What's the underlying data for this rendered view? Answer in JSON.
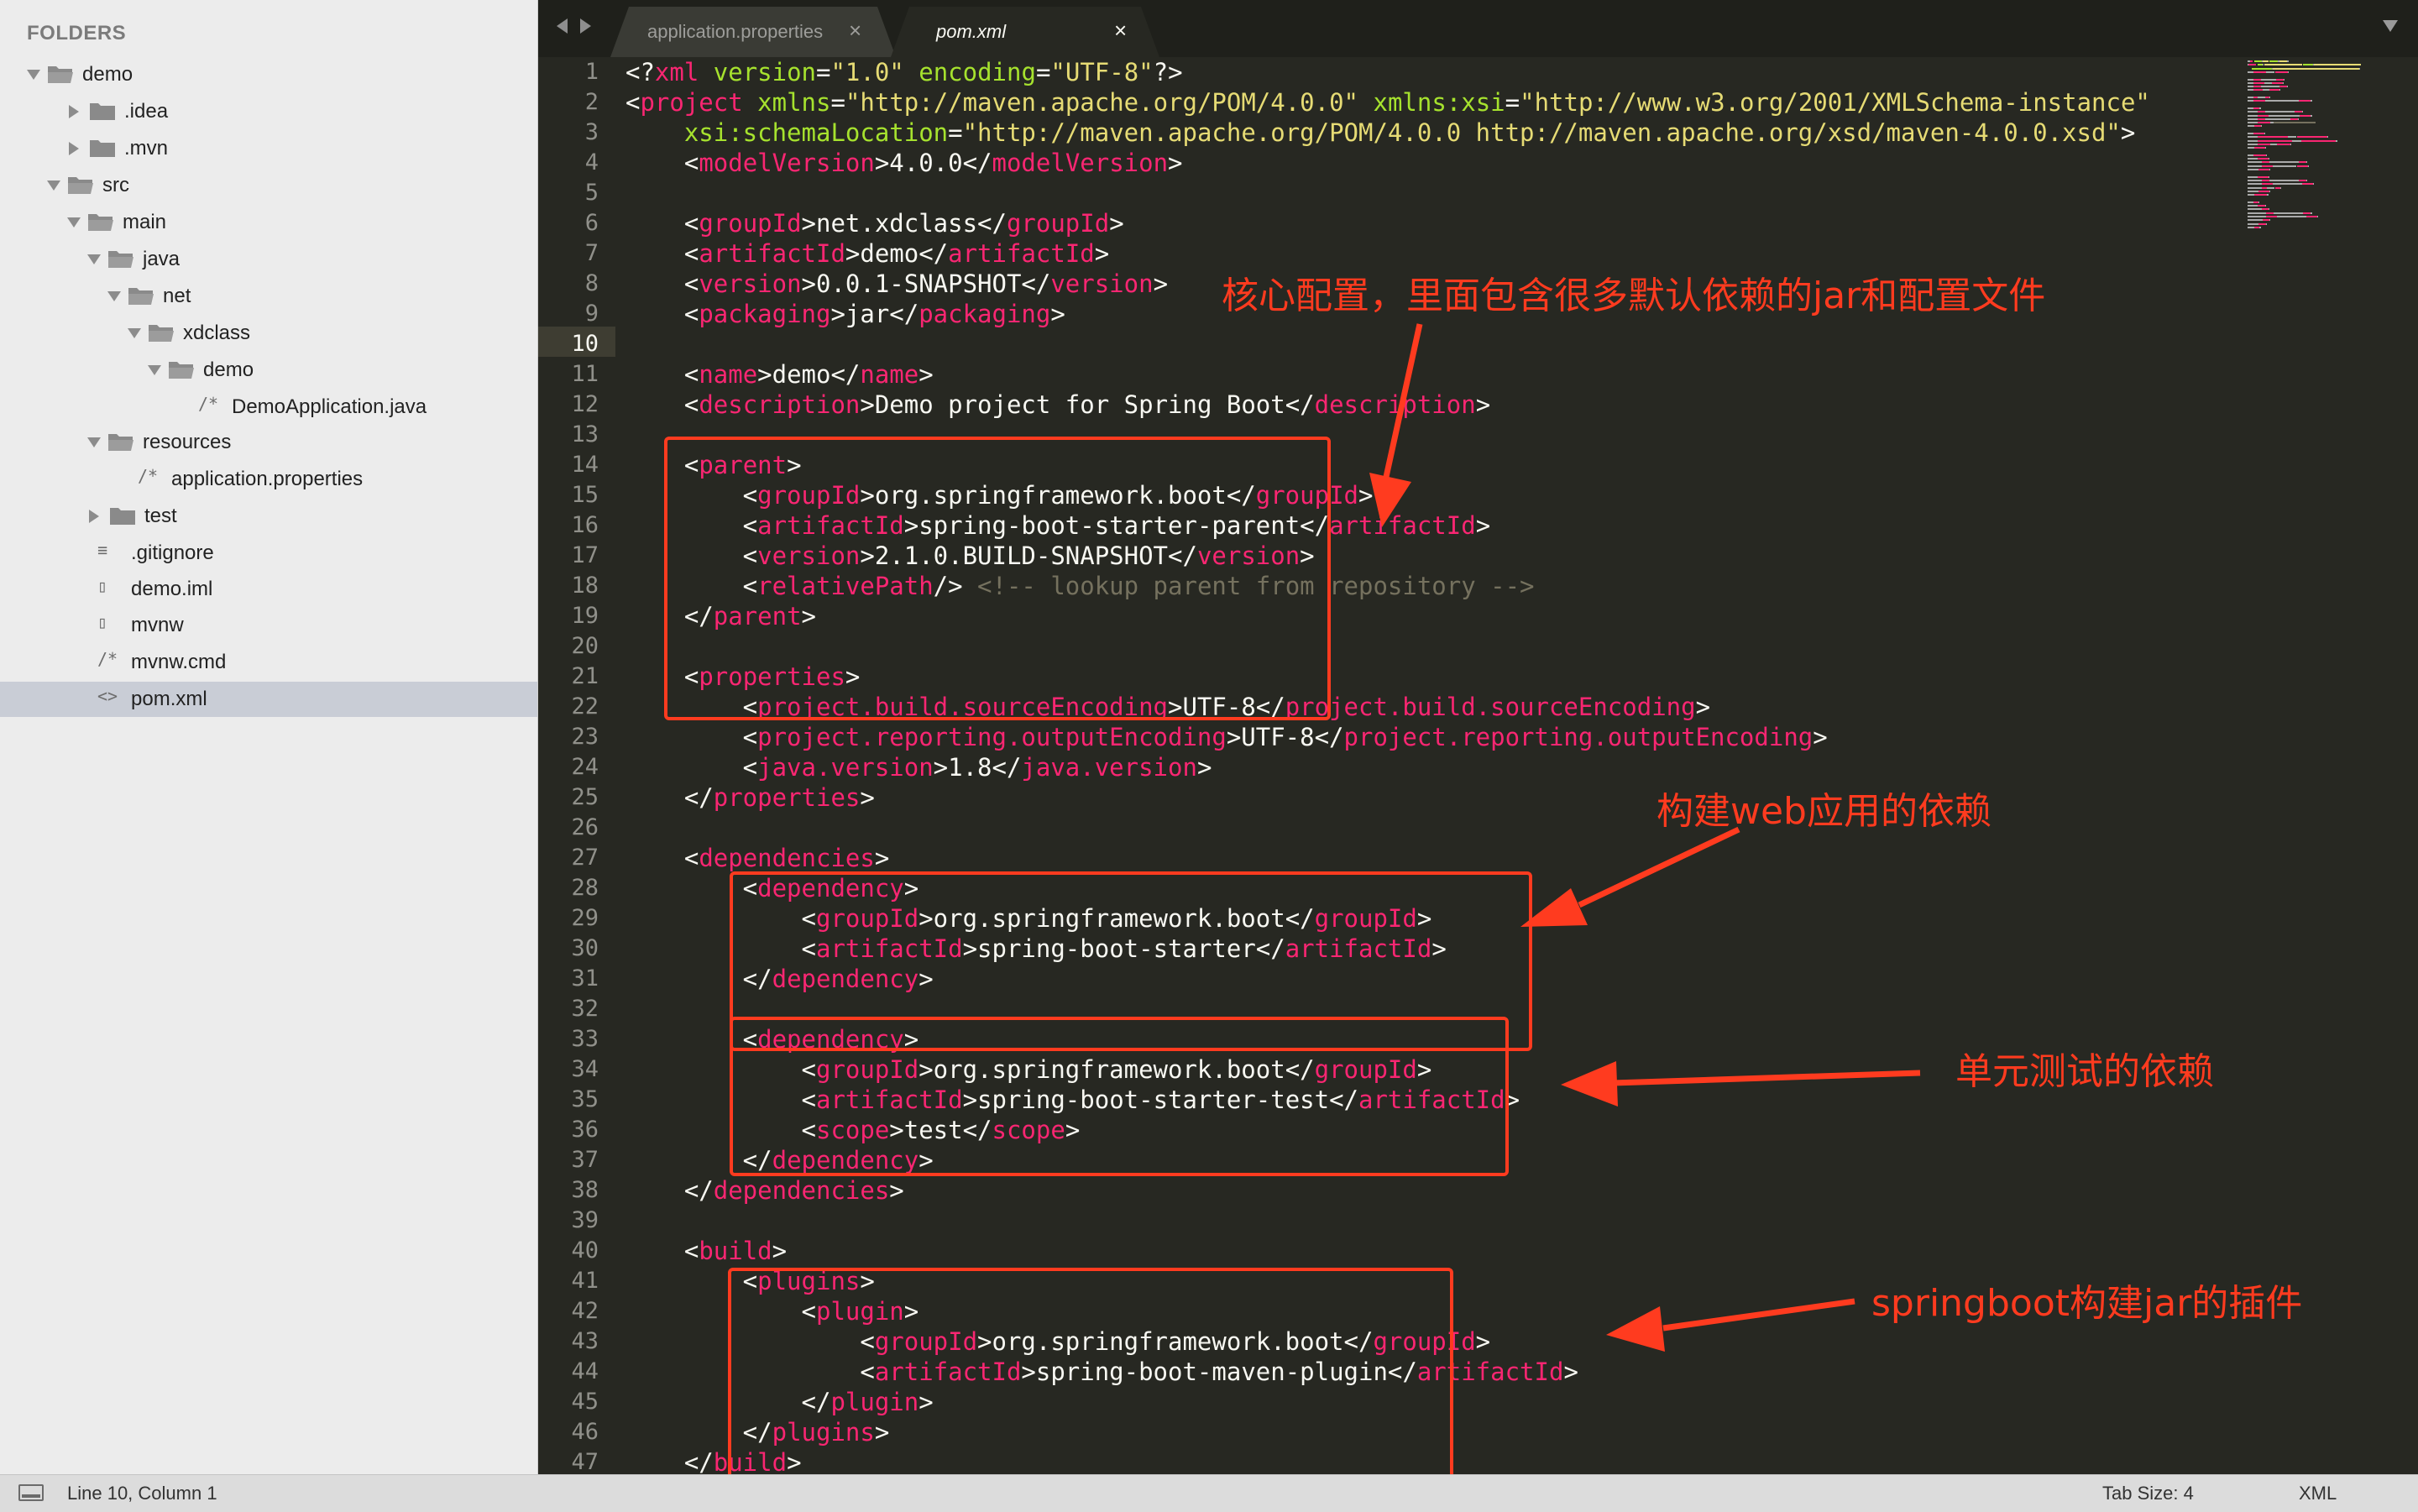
{
  "sidebar": {
    "title": "FOLDERS",
    "items": [
      {
        "label": "demo",
        "kind": "folder",
        "depth": 0,
        "expanded": true
      },
      {
        "label": ".idea",
        "kind": "folder",
        "depth": 1,
        "expanded": false
      },
      {
        "label": ".mvn",
        "kind": "folder",
        "depth": 1,
        "expanded": false
      },
      {
        "label": "src",
        "kind": "folder",
        "depth": 1,
        "expanded": true
      },
      {
        "label": "main",
        "kind": "folder",
        "depth": 2,
        "expanded": true
      },
      {
        "label": "java",
        "kind": "folder",
        "depth": 3,
        "expanded": true
      },
      {
        "label": "net",
        "kind": "folder",
        "depth": 4,
        "expanded": true
      },
      {
        "label": "xdclass",
        "kind": "folder",
        "depth": 5,
        "expanded": true
      },
      {
        "label": "demo",
        "kind": "folder",
        "depth": 6,
        "expanded": true
      },
      {
        "label": "DemoApplication.java",
        "kind": "file",
        "glyph": "/*",
        "depth": 7
      },
      {
        "label": "resources",
        "kind": "folder",
        "depth": 3,
        "expanded": true
      },
      {
        "label": "application.properties",
        "kind": "file",
        "glyph": "/*",
        "depth": 4
      },
      {
        "label": "test",
        "kind": "folder",
        "depth": 2,
        "expanded": false
      },
      {
        "label": ".gitignore",
        "kind": "file",
        "glyph": "≡",
        "depth": 2
      },
      {
        "label": "demo.iml",
        "kind": "file",
        "glyph": "▯",
        "depth": 2
      },
      {
        "label": "mvnw",
        "kind": "file",
        "glyph": "▯",
        "depth": 2
      },
      {
        "label": "mvnw.cmd",
        "kind": "file",
        "glyph": "/*",
        "depth": 2
      },
      {
        "label": "pom.xml",
        "kind": "file",
        "glyph": "<>",
        "depth": 2,
        "selected": true
      }
    ]
  },
  "tabs": [
    {
      "label": "application.properties",
      "close": "×",
      "active": false
    },
    {
      "label": "pom.xml",
      "close": "×",
      "active": true
    }
  ],
  "editor": {
    "current_line": 10,
    "lines": [
      [
        [
          "b",
          "<?"
        ],
        [
          "t",
          "xml"
        ],
        [
          "b",
          " "
        ],
        [
          "a",
          "version"
        ],
        [
          "b",
          "="
        ],
        [
          "s",
          "\"1.0\""
        ],
        [
          "b",
          " "
        ],
        [
          "a",
          "encoding"
        ],
        [
          "b",
          "="
        ],
        [
          "s",
          "\"UTF-8\""
        ],
        [
          "b",
          "?>"
        ]
      ],
      [
        [
          "b",
          "<"
        ],
        [
          "t",
          "project"
        ],
        [
          "b",
          " "
        ],
        [
          "a",
          "xmlns"
        ],
        [
          "b",
          "="
        ],
        [
          "s",
          "\"http://maven.apache.org/POM/4.0.0\""
        ],
        [
          "b",
          " "
        ],
        [
          "a",
          "xmlns:xsi"
        ],
        [
          "b",
          "="
        ],
        [
          "s",
          "\"http://www.w3.org/2001/XMLSchema-instance\""
        ]
      ],
      [
        [
          "b",
          "    "
        ],
        [
          "a",
          "xsi:schemaLocation"
        ],
        [
          "b",
          "="
        ],
        [
          "s",
          "\"http://maven.apache.org/POM/4.0.0 http://maven.apache.org/xsd/maven-4.0.0.xsd\""
        ],
        [
          "b",
          ">"
        ]
      ],
      [
        [
          "b",
          "    <"
        ],
        [
          "t",
          "modelVersion"
        ],
        [
          "b",
          ">4.0.0</"
        ],
        [
          "t",
          "modelVersion"
        ],
        [
          "b",
          ">"
        ]
      ],
      [],
      [
        [
          "b",
          "    <"
        ],
        [
          "t",
          "groupId"
        ],
        [
          "b",
          ">net.xdclass</"
        ],
        [
          "t",
          "groupId"
        ],
        [
          "b",
          ">"
        ]
      ],
      [
        [
          "b",
          "    <"
        ],
        [
          "t",
          "artifactId"
        ],
        [
          "b",
          ">demo</"
        ],
        [
          "t",
          "artifactId"
        ],
        [
          "b",
          ">"
        ]
      ],
      [
        [
          "b",
          "    <"
        ],
        [
          "t",
          "version"
        ],
        [
          "b",
          ">0.0.1-SNAPSHOT</"
        ],
        [
          "t",
          "version"
        ],
        [
          "b",
          ">"
        ]
      ],
      [
        [
          "b",
          "    <"
        ],
        [
          "t",
          "packaging"
        ],
        [
          "b",
          ">jar</"
        ],
        [
          "t",
          "packaging"
        ],
        [
          "b",
          ">"
        ]
      ],
      [],
      [
        [
          "b",
          "    <"
        ],
        [
          "t",
          "name"
        ],
        [
          "b",
          ">demo</"
        ],
        [
          "t",
          "name"
        ],
        [
          "b",
          ">"
        ]
      ],
      [
        [
          "b",
          "    <"
        ],
        [
          "t",
          "description"
        ],
        [
          "b",
          ">Demo project for Spring Boot</"
        ],
        [
          "t",
          "description"
        ],
        [
          "b",
          ">"
        ]
      ],
      [],
      [
        [
          "b",
          "    <"
        ],
        [
          "t",
          "parent"
        ],
        [
          "b",
          ">"
        ]
      ],
      [
        [
          "b",
          "        <"
        ],
        [
          "t",
          "groupId"
        ],
        [
          "b",
          ">org.springframework.boot</"
        ],
        [
          "t",
          "groupId"
        ],
        [
          "b",
          ">"
        ]
      ],
      [
        [
          "b",
          "        <"
        ],
        [
          "t",
          "artifactId"
        ],
        [
          "b",
          ">spring-boot-starter-parent</"
        ],
        [
          "t",
          "artifactId"
        ],
        [
          "b",
          ">"
        ]
      ],
      [
        [
          "b",
          "        <"
        ],
        [
          "t",
          "version"
        ],
        [
          "b",
          ">2.1.0.BUILD-SNAPSHOT</"
        ],
        [
          "t",
          "version"
        ],
        [
          "b",
          ">"
        ]
      ],
      [
        [
          "b",
          "        <"
        ],
        [
          "t",
          "relativePath"
        ],
        [
          "b",
          "/> "
        ],
        [
          "c",
          "<!-- lookup parent from repository -->"
        ]
      ],
      [
        [
          "b",
          "    </"
        ],
        [
          "t",
          "parent"
        ],
        [
          "b",
          ">"
        ]
      ],
      [],
      [
        [
          "b",
          "    <"
        ],
        [
          "t",
          "properties"
        ],
        [
          "b",
          ">"
        ]
      ],
      [
        [
          "b",
          "        <"
        ],
        [
          "t",
          "project.build.sourceEncoding"
        ],
        [
          "b",
          ">UTF-8</"
        ],
        [
          "t",
          "project.build.sourceEncoding"
        ],
        [
          "b",
          ">"
        ]
      ],
      [
        [
          "b",
          "        <"
        ],
        [
          "t",
          "project.reporting.outputEncoding"
        ],
        [
          "b",
          ">UTF-8</"
        ],
        [
          "t",
          "project.reporting.outputEncoding"
        ],
        [
          "b",
          ">"
        ]
      ],
      [
        [
          "b",
          "        <"
        ],
        [
          "t",
          "java.version"
        ],
        [
          "b",
          ">1.8</"
        ],
        [
          "t",
          "java.version"
        ],
        [
          "b",
          ">"
        ]
      ],
      [
        [
          "b",
          "    </"
        ],
        [
          "t",
          "properties"
        ],
        [
          "b",
          ">"
        ]
      ],
      [],
      [
        [
          "b",
          "    <"
        ],
        [
          "t",
          "dependencies"
        ],
        [
          "b",
          ">"
        ]
      ],
      [
        [
          "b",
          "        <"
        ],
        [
          "t",
          "dependency"
        ],
        [
          "b",
          ">"
        ]
      ],
      [
        [
          "b",
          "            <"
        ],
        [
          "t",
          "groupId"
        ],
        [
          "b",
          ">org.springframework.boot</"
        ],
        [
          "t",
          "groupId"
        ],
        [
          "b",
          ">"
        ]
      ],
      [
        [
          "b",
          "            <"
        ],
        [
          "t",
          "artifactId"
        ],
        [
          "b",
          ">spring-boot-starter</"
        ],
        [
          "t",
          "artifactId"
        ],
        [
          "b",
          ">"
        ]
      ],
      [
        [
          "b",
          "        </"
        ],
        [
          "t",
          "dependency"
        ],
        [
          "b",
          ">"
        ]
      ],
      [],
      [
        [
          "b",
          "        <"
        ],
        [
          "t",
          "dependency"
        ],
        [
          "b",
          ">"
        ]
      ],
      [
        [
          "b",
          "            <"
        ],
        [
          "t",
          "groupId"
        ],
        [
          "b",
          ">org.springframework.boot</"
        ],
        [
          "t",
          "groupId"
        ],
        [
          "b",
          ">"
        ]
      ],
      [
        [
          "b",
          "            <"
        ],
        [
          "t",
          "artifactId"
        ],
        [
          "b",
          ">spring-boot-starter-test</"
        ],
        [
          "t",
          "artifactId"
        ],
        [
          "b",
          ">"
        ]
      ],
      [
        [
          "b",
          "            <"
        ],
        [
          "t",
          "scope"
        ],
        [
          "b",
          ">test</"
        ],
        [
          "t",
          "scope"
        ],
        [
          "b",
          ">"
        ]
      ],
      [
        [
          "b",
          "        </"
        ],
        [
          "t",
          "dependency"
        ],
        [
          "b",
          ">"
        ]
      ],
      [
        [
          "b",
          "    </"
        ],
        [
          "t",
          "dependencies"
        ],
        [
          "b",
          ">"
        ]
      ],
      [],
      [
        [
          "b",
          "    <"
        ],
        [
          "t",
          "build"
        ],
        [
          "b",
          ">"
        ]
      ],
      [
        [
          "b",
          "        <"
        ],
        [
          "t",
          "plugins"
        ],
        [
          "b",
          ">"
        ]
      ],
      [
        [
          "b",
          "            <"
        ],
        [
          "t",
          "plugin"
        ],
        [
          "b",
          ">"
        ]
      ],
      [
        [
          "b",
          "                <"
        ],
        [
          "t",
          "groupId"
        ],
        [
          "b",
          ">org.springframework.boot</"
        ],
        [
          "t",
          "groupId"
        ],
        [
          "b",
          ">"
        ]
      ],
      [
        [
          "b",
          "                <"
        ],
        [
          "t",
          "artifactId"
        ],
        [
          "b",
          ">spring-boot-maven-plugin</"
        ],
        [
          "t",
          "artifactId"
        ],
        [
          "b",
          ">"
        ]
      ],
      [
        [
          "b",
          "            </"
        ],
        [
          "t",
          "plugin"
        ],
        [
          "b",
          ">"
        ]
      ],
      [
        [
          "b",
          "        </"
        ],
        [
          "t",
          "plugins"
        ],
        [
          "b",
          ">"
        ]
      ],
      [
        [
          "b",
          "    </"
        ],
        [
          "t",
          "build"
        ],
        [
          "b",
          ">"
        ]
      ]
    ]
  },
  "annotations": {
    "core_config": "核心配置，里面包含很多默认依赖的jar和配置文件",
    "web_dependency": "构建web应用的依赖",
    "test_dependency": "单元测试的依赖",
    "maven_plugin": "springboot构建jar的插件",
    "color": "#ff3b1f"
  },
  "statusbar": {
    "position": "Line 10, Column 1",
    "tab_size": "Tab Size: 4",
    "syntax": "XML"
  },
  "colors": {
    "editor_bg": "#272822",
    "tag": "#f92672",
    "attribute": "#a6e22e",
    "string": "#e6db74",
    "comment": "#75715e",
    "text": "#f8f8f2"
  }
}
